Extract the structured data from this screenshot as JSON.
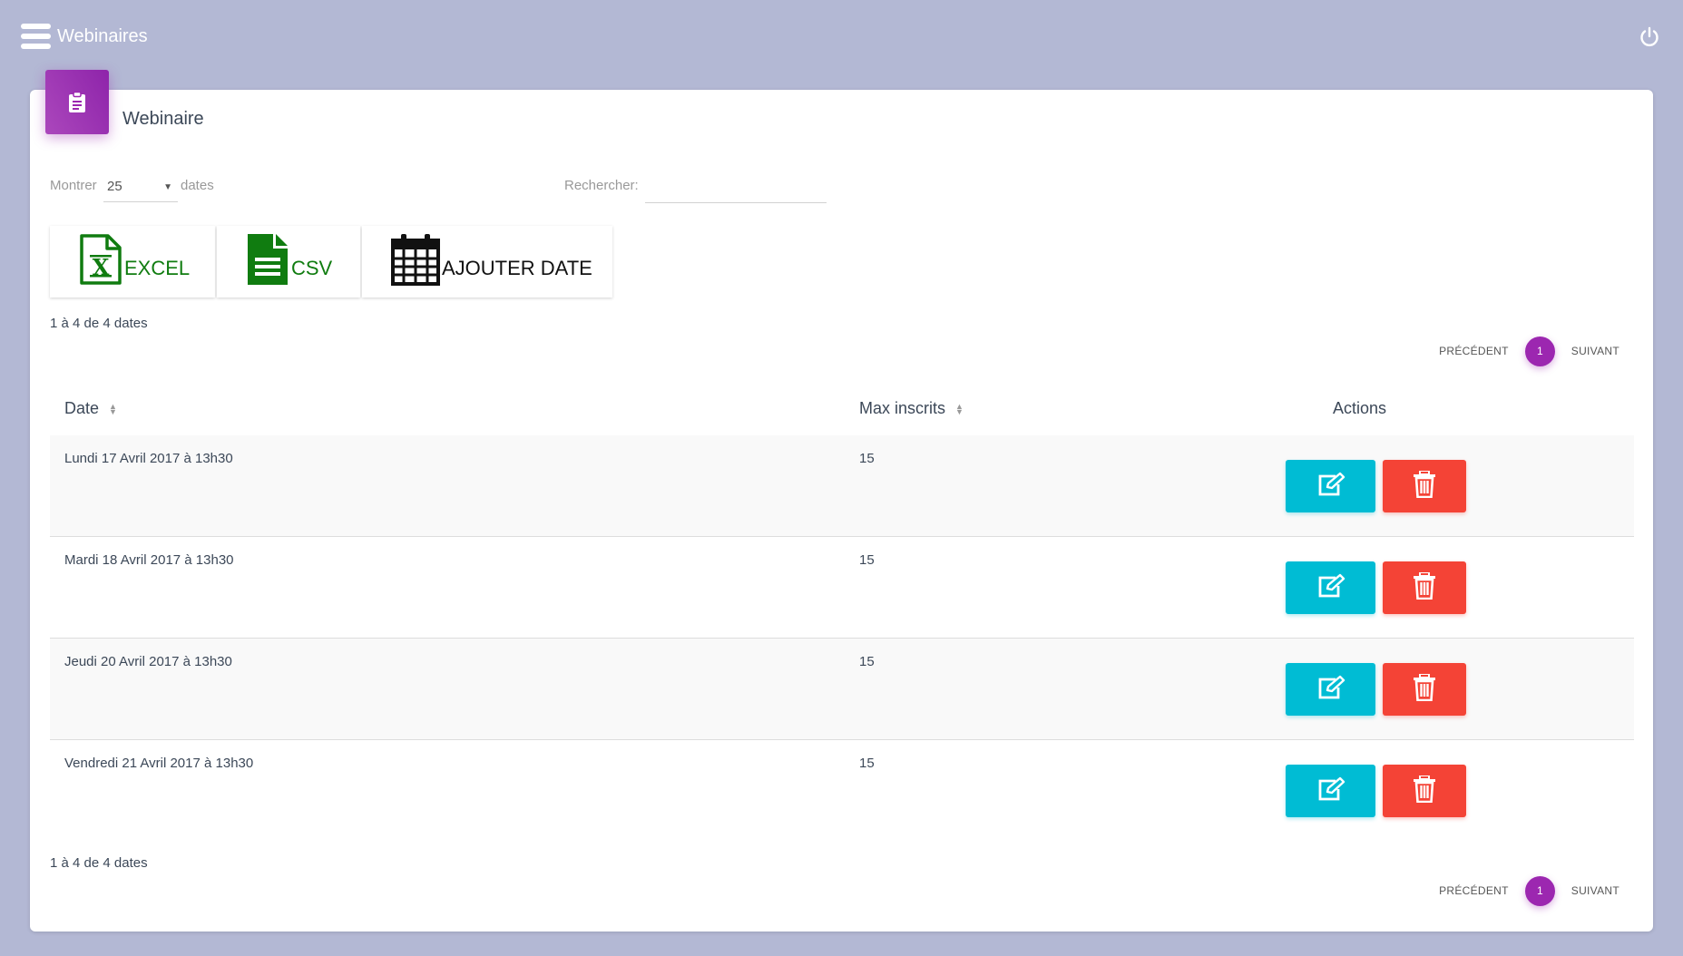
{
  "app": {
    "title": "Webinaires"
  },
  "card": {
    "title": "Webinaire"
  },
  "controls": {
    "length_label": "Montrer",
    "length_value": "25",
    "length_suffix": "dates",
    "search_label": "Rechercher:",
    "search_value": ""
  },
  "toolbar": {
    "excel_label": "EXCEL",
    "csv_label": "CSV",
    "add_label": "AJOUTER DATE"
  },
  "info": {
    "text": "1 à 4 de 4 dates"
  },
  "pagination": {
    "previous": "PRÉCÉDENT",
    "current": "1",
    "next": "SUIVANT"
  },
  "table": {
    "headers": {
      "date": "Date",
      "max": "Max inscrits",
      "actions": "Actions"
    },
    "rows": [
      {
        "date": "Lundi 17 Avril 2017 à 13h30",
        "max": "15"
      },
      {
        "date": "Mardi 18 Avril 2017 à 13h30",
        "max": "15"
      },
      {
        "date": "Jeudi 20 Avril 2017 à 13h30",
        "max": "15"
      },
      {
        "date": "Vendredi 21 Avril 2017 à 13h30",
        "max": "15"
      }
    ]
  },
  "colors": {
    "accent": "#9c27b0",
    "edit": "#00bcd4",
    "delete": "#f44336",
    "excel": "#107c10",
    "background": "#b3b8d4"
  },
  "icons": {
    "menu": "menu-icon",
    "power": "power-icon",
    "card": "clipboard-icon",
    "excel": "excel-file-icon",
    "csv": "csv-file-icon",
    "add": "calendar-icon",
    "edit": "edit-icon",
    "delete": "trash-icon"
  }
}
